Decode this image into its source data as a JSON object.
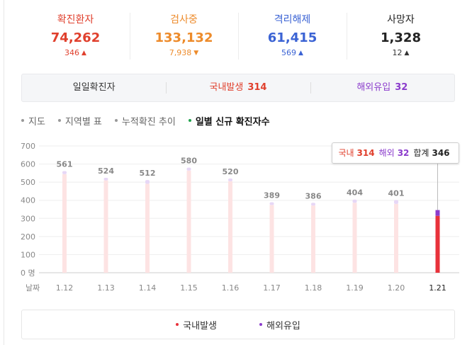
{
  "stats": [
    {
      "label": "확진환자",
      "value": "74,262",
      "delta": "346",
      "direction": "up",
      "color": "#e0402d",
      "delta_color": "#e0402d",
      "arrow_color": "#e0402d"
    },
    {
      "label": "검사중",
      "value": "133,132",
      "delta": "7,938",
      "direction": "down",
      "color": "#ed8b2b",
      "delta_color": "#ed8b2b",
      "arrow_color": "#ed8b2b"
    },
    {
      "label": "격리해제",
      "value": "61,415",
      "delta": "569",
      "direction": "up",
      "color": "#3b63d4",
      "delta_color": "#3b63d4",
      "arrow_color": "#3b63d4"
    },
    {
      "label": "사망자",
      "value": "1,328",
      "delta": "12",
      "direction": "up",
      "color": "#222222",
      "delta_color": "#333333",
      "arrow_color": "#333333"
    }
  ],
  "tabs": [
    {
      "label": "일일확진자",
      "count": "",
      "color": "#333333"
    },
    {
      "label": "국내발생",
      "count": "314",
      "color": "#e0402d"
    },
    {
      "label": "해외유입",
      "count": "32",
      "color": "#8b3ccc"
    }
  ],
  "submenu": [
    {
      "label": "지도",
      "active": false
    },
    {
      "label": "지역별 표",
      "active": false
    },
    {
      "label": "누적확진 추이",
      "active": false
    },
    {
      "label": "일별 신규 확진자수",
      "active": true
    }
  ],
  "colors": {
    "domestic": "#e8323b",
    "overseas": "#8b3ccc",
    "bar_faded_domestic": "#fde3e3",
    "bar_faded_overseas": "#e7d7f6"
  },
  "chart_data": {
    "type": "bar",
    "stacked": true,
    "categories": [
      "1.12",
      "1.13",
      "1.14",
      "1.15",
      "1.16",
      "1.17",
      "1.18",
      "1.19",
      "1.20",
      "1.21"
    ],
    "series": [
      {
        "name": "국내발생",
        "values": [
          544,
          510,
          491,
          564,
          505,
          374,
          371,
          386,
          380,
          314
        ]
      },
      {
        "name": "해외유입",
        "values": [
          17,
          14,
          21,
          16,
          15,
          15,
          15,
          18,
          21,
          32
        ]
      }
    ],
    "totals": [
      561,
      524,
      512,
      580,
      520,
      389,
      386,
      404,
      401,
      346
    ],
    "total_labels": [
      "561",
      "524",
      "512",
      "580",
      "520",
      "389",
      "386",
      "404",
      "401",
      ""
    ],
    "highlighted_index": 9,
    "yticks": [
      "700",
      "600",
      "500",
      "400",
      "300",
      "200",
      "100",
      "0 명"
    ],
    "ylim": [
      0,
      700
    ],
    "xlabel": "날짜",
    "grid": true
  },
  "tooltip": {
    "domestic_label": "국내",
    "domestic_value": "314",
    "overseas_label": "해외",
    "overseas_value": "32",
    "total_label": "합계",
    "total_value": "346"
  },
  "legend": [
    {
      "label": "국내발생",
      "color": "#e8323b"
    },
    {
      "label": "해외유입",
      "color": "#8b3ccc"
    }
  ]
}
